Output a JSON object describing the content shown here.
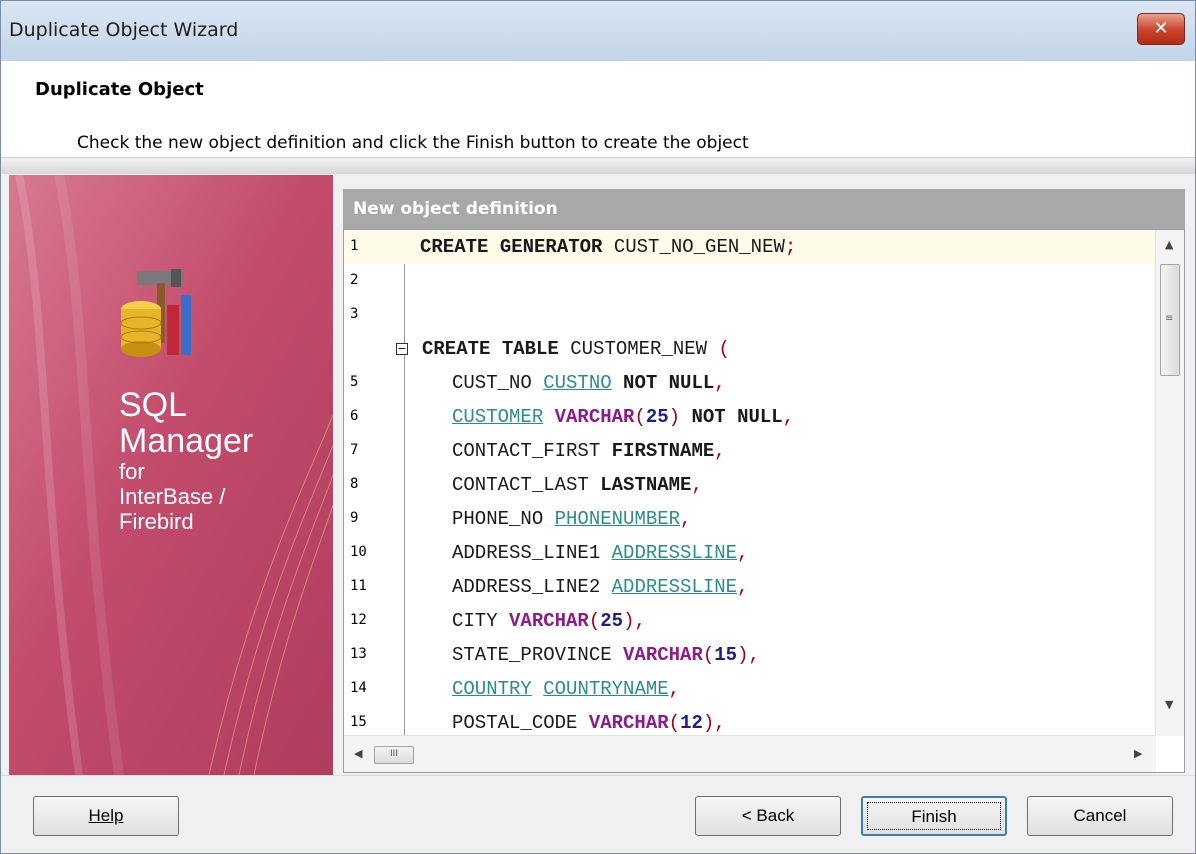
{
  "window": {
    "title": "Duplicate Object Wizard",
    "close_label": "✕"
  },
  "header": {
    "title": "Duplicate Object",
    "description": "Check the new object definition and click the Finish button to create the object"
  },
  "sidebar": {
    "product_line1": "SQL",
    "product_line2": "Manager",
    "product_line3": "for",
    "product_line4": "InterBase /",
    "product_line5": "Firebird"
  },
  "panel": {
    "heading": "New object definition"
  },
  "editor": {
    "line_numbers": [
      "1",
      "2",
      "3",
      "",
      "5",
      "6",
      "7",
      "8",
      "9",
      "10",
      "11",
      "12",
      "13",
      "14",
      "15"
    ],
    "lines": [
      [
        {
          "t": "CREATE GENERATOR ",
          "c": "kw"
        },
        {
          "t": "CUST_NO_GEN_NEW",
          "c": ""
        },
        {
          "t": ";",
          "c": "punc"
        }
      ],
      [],
      [],
      [
        {
          "t": "CREATE TABLE ",
          "c": "kw"
        },
        {
          "t": "CUSTOMER_NEW ",
          "c": ""
        },
        {
          "t": "(",
          "c": "punc"
        }
      ],
      [
        {
          "t": "CUST_NO ",
          "c": ""
        },
        {
          "t": "CUSTNO",
          "c": "dm"
        },
        {
          "t": " NOT NULL",
          "c": "kw"
        },
        {
          "t": ",",
          "c": "punc"
        }
      ],
      [
        {
          "t": "CUSTOMER",
          "c": "dm"
        },
        {
          "t": " ",
          "c": ""
        },
        {
          "t": "VARCHAR",
          "c": "ty"
        },
        {
          "t": "(",
          "c": "punc"
        },
        {
          "t": "25",
          "c": "num"
        },
        {
          "t": ")",
          "c": "punc"
        },
        {
          "t": " NOT NULL",
          "c": "kw"
        },
        {
          "t": ",",
          "c": "punc"
        }
      ],
      [
        {
          "t": "CONTACT_FIRST ",
          "c": ""
        },
        {
          "t": "FIRSTNAME",
          "c": "kw"
        },
        {
          "t": ",",
          "c": "punc"
        }
      ],
      [
        {
          "t": "CONTACT_LAST ",
          "c": ""
        },
        {
          "t": "LASTNAME",
          "c": "kw"
        },
        {
          "t": ",",
          "c": "punc"
        }
      ],
      [
        {
          "t": "PHONE_NO ",
          "c": ""
        },
        {
          "t": "PHONENUMBER",
          "c": "dm"
        },
        {
          "t": ",",
          "c": "punc"
        }
      ],
      [
        {
          "t": "ADDRESS_LINE1 ",
          "c": ""
        },
        {
          "t": "ADDRESSLINE",
          "c": "dm"
        },
        {
          "t": ",",
          "c": "punc"
        }
      ],
      [
        {
          "t": "ADDRESS_LINE2 ",
          "c": ""
        },
        {
          "t": "ADDRESSLINE",
          "c": "dm"
        },
        {
          "t": ",",
          "c": "punc"
        }
      ],
      [
        {
          "t": "CITY ",
          "c": ""
        },
        {
          "t": "VARCHAR",
          "c": "ty"
        },
        {
          "t": "(",
          "c": "punc"
        },
        {
          "t": "25",
          "c": "num"
        },
        {
          "t": ")",
          "c": "punc"
        },
        {
          "t": ",",
          "c": "punc"
        }
      ],
      [
        {
          "t": "STATE_PROVINCE ",
          "c": ""
        },
        {
          "t": "VARCHAR",
          "c": "ty"
        },
        {
          "t": "(",
          "c": "punc"
        },
        {
          "t": "15",
          "c": "num"
        },
        {
          "t": ")",
          "c": "punc"
        },
        {
          "t": ",",
          "c": "punc"
        }
      ],
      [
        {
          "t": "COUNTRY",
          "c": "dm"
        },
        {
          "t": " ",
          "c": ""
        },
        {
          "t": "COUNTRYNAME",
          "c": "dm"
        },
        {
          "t": ",",
          "c": "punc"
        }
      ],
      [
        {
          "t": "POSTAL_CODE ",
          "c": ""
        },
        {
          "t": "VARCHAR",
          "c": "ty"
        },
        {
          "t": "(",
          "c": "punc"
        },
        {
          "t": "12",
          "c": "num"
        },
        {
          "t": ")",
          "c": "punc"
        },
        {
          "t": ",",
          "c": "punc"
        }
      ]
    ],
    "hscroll_grip": "III"
  },
  "buttons": {
    "help": "Help",
    "back": "< Back",
    "finish": "Finish",
    "cancel": "Cancel"
  },
  "colors": {
    "sidebar_accent": "#c34c6c",
    "keyword_type": "#8b1d8b",
    "domain": "#2e8b8b",
    "number": "#1d1d8b"
  }
}
